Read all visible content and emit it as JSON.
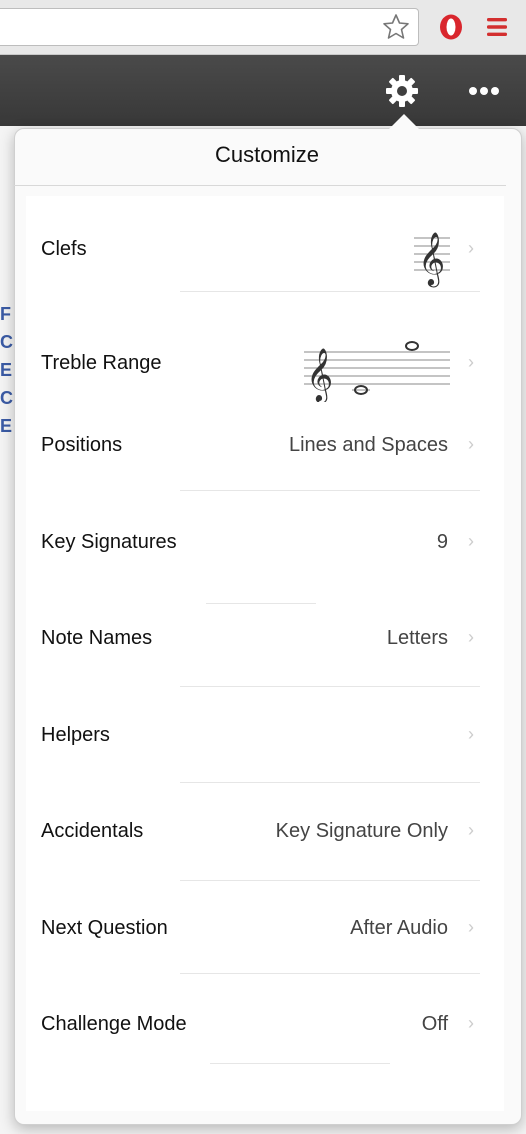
{
  "colors": {
    "toolbar": "#3f3f3f",
    "opera_red": "#d9262d",
    "menu_red": "#d32f2f",
    "popover_bg": "#fafafa"
  },
  "browser": {
    "star_icon": "star-icon",
    "opera_icon": "opera-icon",
    "menu_icon": "hamburger-menu-icon"
  },
  "toolbar": {
    "gear_icon": "gear-icon",
    "more_icon": "ellipsis-icon"
  },
  "background_letters": [
    "F",
    "C",
    "E",
    "C",
    "E"
  ],
  "popover": {
    "title": "Customize",
    "rows": [
      {
        "label": "Clefs",
        "value": "",
        "graphic": "treble-clef-staff"
      },
      {
        "label": "Treble Range",
        "value": "",
        "graphic": "treble-range-staff"
      },
      {
        "label": "Positions",
        "value": "Lines and Spaces"
      },
      {
        "label": "Key Signatures",
        "value": "9"
      },
      {
        "label": "Note Names",
        "value": "Letters"
      },
      {
        "label": "Helpers",
        "value": ""
      },
      {
        "label": "Accidentals",
        "value": "Key Signature Only"
      },
      {
        "label": "Next Question",
        "value": "After Audio"
      },
      {
        "label": "Challenge Mode",
        "value": "Off"
      }
    ]
  }
}
